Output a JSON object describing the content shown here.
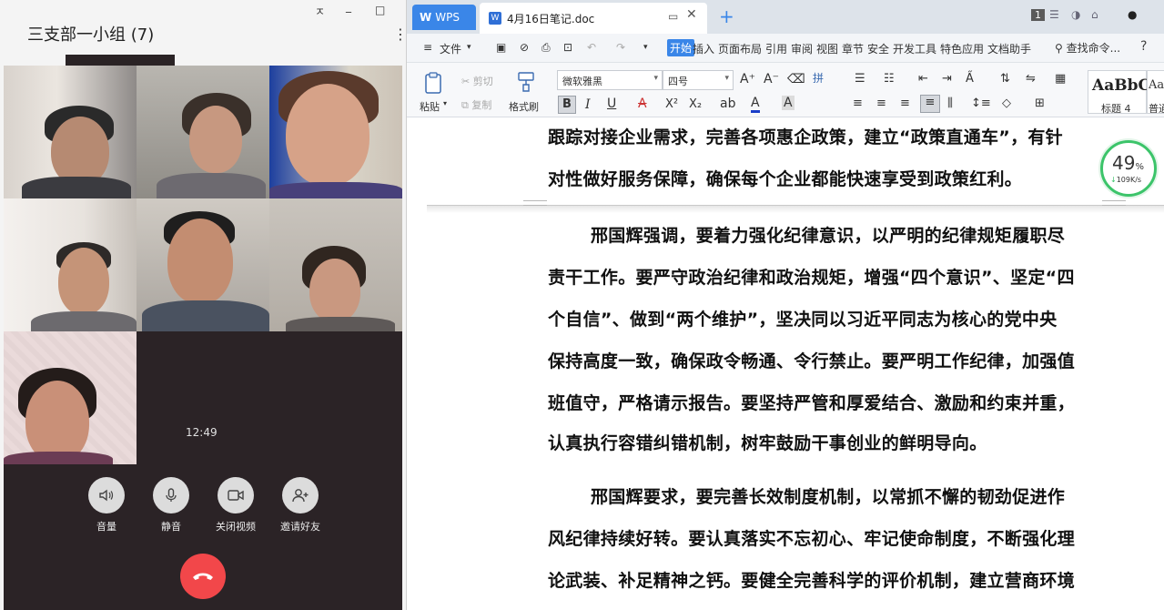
{
  "chat": {
    "title": "三支部一小组 (7)",
    "controls": {
      "pin": "ㅈ",
      "minimize": "_",
      "maximize": "□",
      "more": "⋮"
    },
    "video_controls": {
      "pin": "ㅈ",
      "minimize": "_",
      "maximize": "□",
      "close": "✕"
    },
    "timer": "12:49",
    "buttons": [
      {
        "label": "音量",
        "icon": "speaker-icon"
      },
      {
        "label": "静音",
        "icon": "microphone-icon"
      },
      {
        "label": "关闭视频",
        "icon": "camera-icon"
      },
      {
        "label": "邀请好友",
        "icon": "add-user-icon"
      }
    ],
    "hangup_icon": "phone-hangup-icon"
  },
  "wps": {
    "tabs": {
      "app": "WPS",
      "doc": "4月16日笔记.doc",
      "badge": "1"
    },
    "menu": [
      "文件",
      "开始",
      "插入",
      "页面布局",
      "引用",
      "审阅",
      "视图",
      "章节",
      "安全",
      "开发工具",
      "特色应用",
      "文档助手"
    ],
    "search": "查找命令...",
    "help": "?",
    "ribbon": {
      "paste": "粘贴",
      "cut": "剪切",
      "copy": "复制",
      "format_painter": "格式刷",
      "font": "微软雅黑",
      "size": "四号",
      "style_sample": "AaBbC",
      "style_name": "标题 4",
      "style2_sample": "AaI",
      "style2_name": "普通"
    },
    "speed": {
      "percent": "49",
      "unit": "%",
      "rate": "109K/s"
    },
    "doc_lines": [
      "跟踪对接企业需求，完善各项惠企政策，建立“政策直通车”，有针",
      "对性做好服务保障，确保每个企业都能快速享受到政策红利。",
      "邢国辉强调，要着力强化纪律意识，以严明的纪律规矩履职尽",
      "责干工作。要严守政治纪律和政治规矩，增强“四个意识”、坚定“四",
      "个自信”、做到“两个维护”，坚决同以习近平同志为核心的党中央",
      "保持高度一致，确保政令畅通、令行禁止。要严明工作纪律，加强值",
      "班值守，严格请示报告。要坚持严管和厚爱结合、激励和约束并重，",
      "认真执行容错纠错机制，树牢鼓励干事创业的鲜明导向。",
      "邢国辉要求，要完善长效制度机制，以常抓不懈的韧劲促进作",
      "风纪律持续好转。要认真落实不忘初心、牢记使命制度，不断强化理",
      "论武装、补足精神之钙。要健全完善科学的评价机制，建立营商环境"
    ]
  }
}
